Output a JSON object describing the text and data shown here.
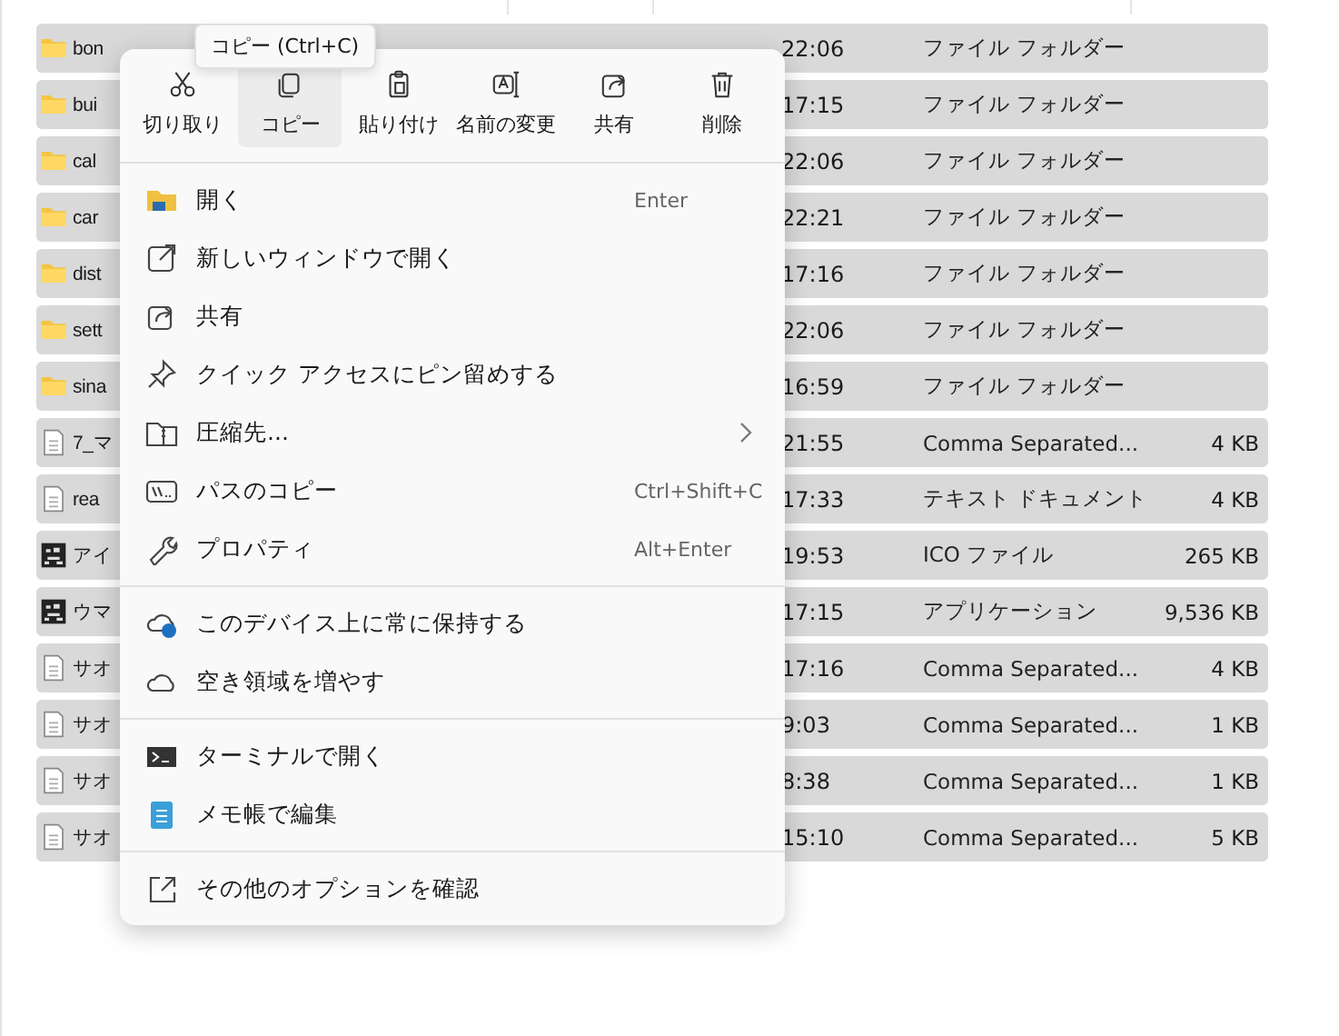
{
  "file_list": {
    "rows": [
      {
        "kind": "folder",
        "name": "bon",
        "date": "22:06",
        "type": "ファイル フォルダー",
        "size": ""
      },
      {
        "kind": "folder",
        "name": "bui",
        "date": "17:15",
        "type": "ファイル フォルダー",
        "size": ""
      },
      {
        "kind": "folder",
        "name": "cal",
        "date": "22:06",
        "type": "ファイル フォルダー",
        "size": ""
      },
      {
        "kind": "folder",
        "name": "car",
        "date": "22:21",
        "type": "ファイル フォルダー",
        "size": ""
      },
      {
        "kind": "folder",
        "name": "dist",
        "date": "17:16",
        "type": "ファイル フォルダー",
        "size": ""
      },
      {
        "kind": "folder",
        "name": "sett",
        "date": "22:06",
        "type": "ファイル フォルダー",
        "size": ""
      },
      {
        "kind": "folder",
        "name": "sina",
        "date": "16:59",
        "type": "ファイル フォルダー",
        "size": ""
      },
      {
        "kind": "file",
        "name": "7_マ",
        "date": "21:55",
        "type": "Comma Separated...",
        "size": "4 KB"
      },
      {
        "kind": "file",
        "name": "rea",
        "date": "17:33",
        "type": "テキスト ドキュメント",
        "size": "4 KB"
      },
      {
        "kind": "image",
        "name": "アイ",
        "date": "19:53",
        "type": "ICO ファイル",
        "size": "265 KB"
      },
      {
        "kind": "image",
        "name": "ウマ",
        "date": "17:15",
        "type": "アプリケーション",
        "size": "9,536 KB"
      },
      {
        "kind": "file",
        "name": "サオ",
        "date": "17:16",
        "type": "Comma Separated...",
        "size": "4 KB"
      },
      {
        "kind": "file",
        "name": "サオ",
        "date": "9:03",
        "type": "Comma Separated...",
        "size": "1 KB"
      },
      {
        "kind": "file",
        "name": "サオ",
        "date": "8:38",
        "type": "Comma Separated...",
        "size": "1 KB"
      },
      {
        "kind": "file",
        "name": "サオ",
        "date": "15:10",
        "type": "Comma Separated...",
        "size": "5 KB"
      }
    ]
  },
  "tooltip": "コピー (Ctrl+C)",
  "context_menu": {
    "toolbar": [
      {
        "label": "切り取り",
        "selected": false
      },
      {
        "label": "コピー",
        "selected": true
      },
      {
        "label": "貼り付け",
        "selected": false
      },
      {
        "label": "名前の変更",
        "selected": false
      },
      {
        "label": "共有",
        "selected": false
      },
      {
        "label": "削除",
        "selected": false
      }
    ],
    "sections": [
      [
        {
          "label": "開く",
          "shortcut": "Enter"
        },
        {
          "label": "新しいウィンドウで開く"
        },
        {
          "label": "共有"
        },
        {
          "label": "クイック アクセスにピン留めする"
        },
        {
          "label": "圧縮先...",
          "submenu": true
        },
        {
          "label": "パスのコピー",
          "shortcut": "Ctrl+Shift+C"
        },
        {
          "label": "プロパティ",
          "shortcut": "Alt+Enter"
        }
      ],
      [
        {
          "label": "このデバイス上に常に保持する"
        },
        {
          "label": "空き領域を増やす"
        }
      ],
      [
        {
          "label": "ターミナルで開く"
        },
        {
          "label": "メモ帳で編集"
        }
      ],
      [
        {
          "label": "その他のオプションを確認"
        }
      ]
    ]
  }
}
